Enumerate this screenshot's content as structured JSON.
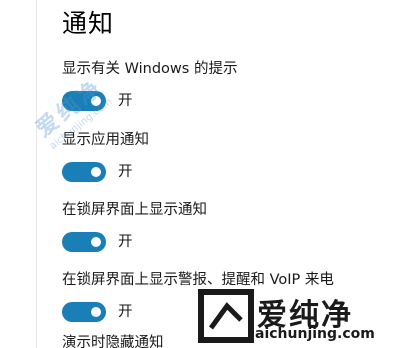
{
  "page": {
    "title": "通知"
  },
  "settings": [
    {
      "label": "显示有关 Windows 的提示",
      "state": "开",
      "on": true
    },
    {
      "label": "显示应用通知",
      "state": "开",
      "on": true
    },
    {
      "label": "在锁屏界面上显示通知",
      "state": "开",
      "on": true
    },
    {
      "label": "在锁屏界面上显示警报、提醒和 VoIP 来电",
      "state": "开",
      "on": true
    },
    {
      "label": "演示时隐藏通知"
    }
  ],
  "watermark": {
    "brand": "爱纯净",
    "url": "aichunjing.com"
  },
  "colors": {
    "accent": "#1a7fb6",
    "background": "#ffffff",
    "text": "#1a1a1a"
  }
}
